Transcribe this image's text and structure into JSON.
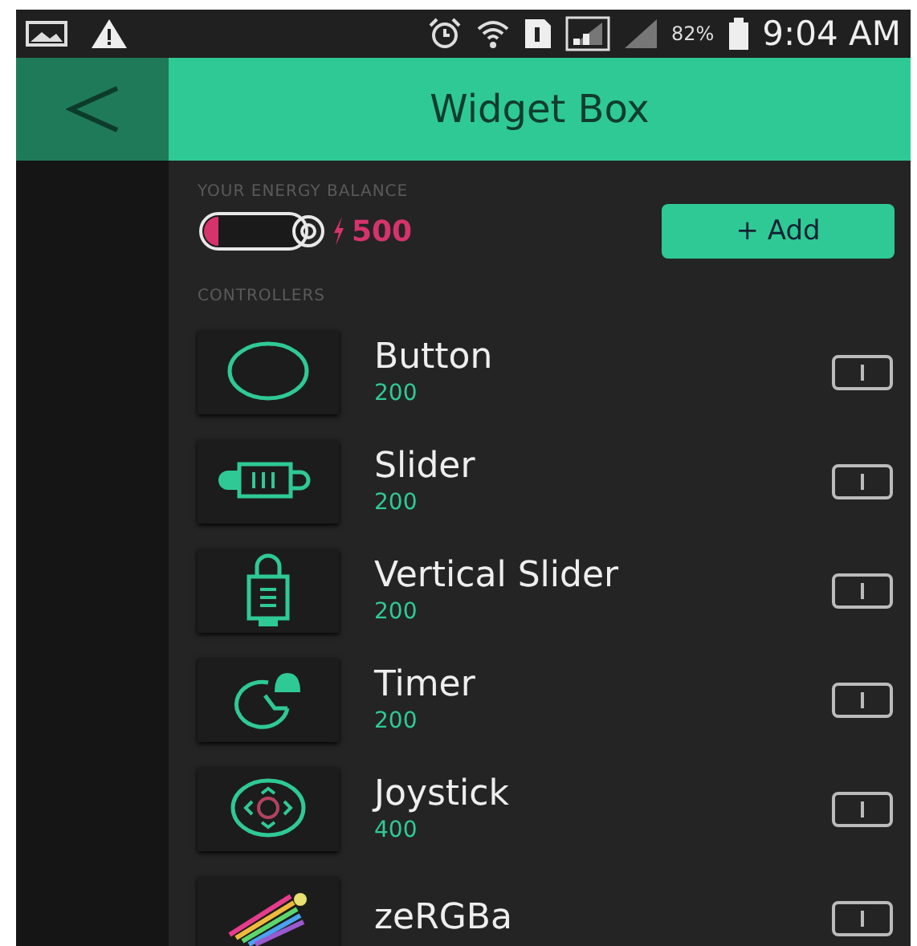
{
  "status_bar": {
    "battery_percent": "82%",
    "time": "9:04 AM"
  },
  "header": {
    "title": "Widget Box"
  },
  "energy": {
    "label": "YOUR ENERGY BALANCE",
    "balance": "500",
    "add_button": "+ Add"
  },
  "section": {
    "label": "CONTROLLERS"
  },
  "widgets": [
    {
      "kind": "button",
      "name": "Button",
      "price": "200"
    },
    {
      "kind": "slider",
      "name": "Slider",
      "price": "200"
    },
    {
      "kind": "vslider",
      "name": "Vertical Slider",
      "price": "200"
    },
    {
      "kind": "timer",
      "name": "Timer",
      "price": "200"
    },
    {
      "kind": "joystick",
      "name": "Joystick",
      "price": "400"
    },
    {
      "kind": "zergba",
      "name": "zeRGBa"
    }
  ]
}
